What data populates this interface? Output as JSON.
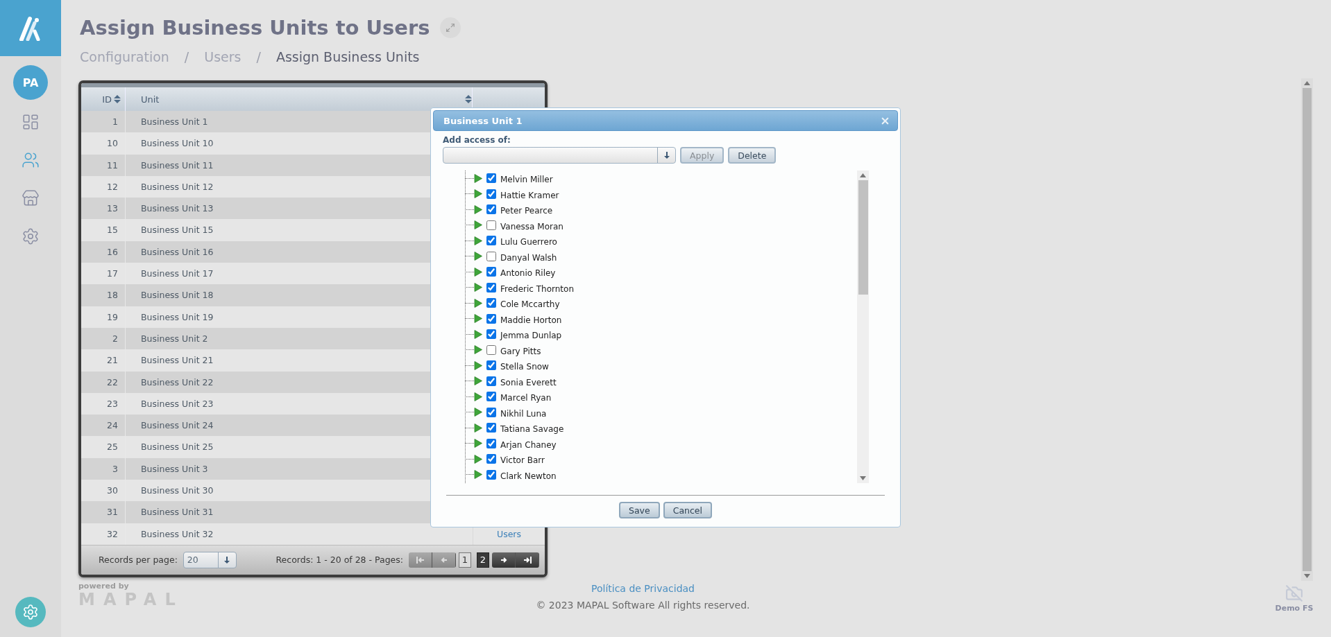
{
  "sidebar": {
    "avatar": "PA",
    "items": [
      {
        "kind": "dashboard",
        "selected": false
      },
      {
        "kind": "users",
        "selected": true
      },
      {
        "kind": "store",
        "selected": false
      },
      {
        "kind": "settings",
        "selected": false
      }
    ]
  },
  "header": {
    "title": "Assign Business Units to Users",
    "breadcrumb": [
      {
        "label": "Configuration",
        "current": false
      },
      {
        "label": "Users",
        "current": false
      },
      {
        "label": "Assign Business Units",
        "current": true
      }
    ],
    "separators": [
      "/",
      "/"
    ]
  },
  "table": {
    "columns": [
      {
        "label": "ID",
        "sortable": true
      },
      {
        "label": "Unit",
        "sortable": true
      }
    ],
    "rows": [
      {
        "id": "1",
        "unit": "Business Unit 1"
      },
      {
        "id": "10",
        "unit": "Business Unit 10"
      },
      {
        "id": "11",
        "unit": "Business Unit 11"
      },
      {
        "id": "12",
        "unit": "Business Unit 12"
      },
      {
        "id": "13",
        "unit": "Business Unit 13"
      },
      {
        "id": "15",
        "unit": "Business Unit 15"
      },
      {
        "id": "16",
        "unit": "Business Unit 16"
      },
      {
        "id": "17",
        "unit": "Business Unit 17"
      },
      {
        "id": "18",
        "unit": "Business Unit 18"
      },
      {
        "id": "19",
        "unit": "Business Unit 19"
      },
      {
        "id": "2",
        "unit": "Business Unit 2"
      },
      {
        "id": "21",
        "unit": "Business Unit 21"
      },
      {
        "id": "22",
        "unit": "Business Unit 22"
      },
      {
        "id": "23",
        "unit": "Business Unit 23"
      },
      {
        "id": "24",
        "unit": "Business Unit 24"
      },
      {
        "id": "25",
        "unit": "Business Unit 25"
      },
      {
        "id": "3",
        "unit": "Business Unit 3"
      },
      {
        "id": "30",
        "unit": "Business Unit 30"
      },
      {
        "id": "31",
        "unit": "Business Unit 31"
      },
      {
        "id": "32",
        "unit": "Business Unit 32",
        "link": "Users"
      }
    ],
    "pager": {
      "per_page_label": "Records per page:",
      "per_page": "20",
      "summary": "Records: 1 - 20 of 28 - Pages:",
      "nav_start": [
        {
          "kind": "first",
          "disabled": true
        },
        {
          "kind": "prev",
          "disabled": true
        }
      ],
      "pages": [
        {
          "label": "1",
          "selected": true
        },
        {
          "label": "2",
          "selected": false
        }
      ],
      "nav_end": [
        {
          "kind": "next",
          "disabled": false
        },
        {
          "kind": "last",
          "disabled": false
        }
      ]
    }
  },
  "dialog": {
    "title": "Business Unit 1",
    "access_label": "Add access of:",
    "actions": [
      {
        "label": "Apply",
        "disabled": true
      },
      {
        "label": "Delete",
        "disabled": false
      }
    ],
    "users": [
      {
        "name": "Melvin Miller",
        "checked": true
      },
      {
        "name": "Hattie Kramer",
        "checked": true
      },
      {
        "name": "Peter Pearce",
        "checked": true
      },
      {
        "name": "Vanessa Moran",
        "checked": false
      },
      {
        "name": "Lulu Guerrero",
        "checked": true
      },
      {
        "name": "Danyal Walsh",
        "checked": false
      },
      {
        "name": "Antonio Riley",
        "checked": true
      },
      {
        "name": "Frederic Thornton",
        "checked": true
      },
      {
        "name": "Cole Mccarthy",
        "checked": true
      },
      {
        "name": "Maddie Horton",
        "checked": true
      },
      {
        "name": "Jemma Dunlap",
        "checked": true
      },
      {
        "name": "Gary Pitts",
        "checked": false
      },
      {
        "name": "Stella Snow",
        "checked": true
      },
      {
        "name": "Sonia Everett",
        "checked": true
      },
      {
        "name": "Marcel Ryan",
        "checked": true
      },
      {
        "name": "Nikhil Luna",
        "checked": true
      },
      {
        "name": "Tatiana Savage",
        "checked": true
      },
      {
        "name": "Arjan Chaney",
        "checked": true
      },
      {
        "name": "Victor Barr",
        "checked": true
      },
      {
        "name": "Clark Newton",
        "checked": true
      }
    ],
    "buttons": [
      "Save",
      "Cancel"
    ]
  },
  "footer": {
    "powered_by": "powered by",
    "brand": "MAPAL",
    "privacy": "Política de Privacidad",
    "copyright": "© 2023 MAPAL Software All rights reserved.",
    "account": "Demo FS"
  }
}
